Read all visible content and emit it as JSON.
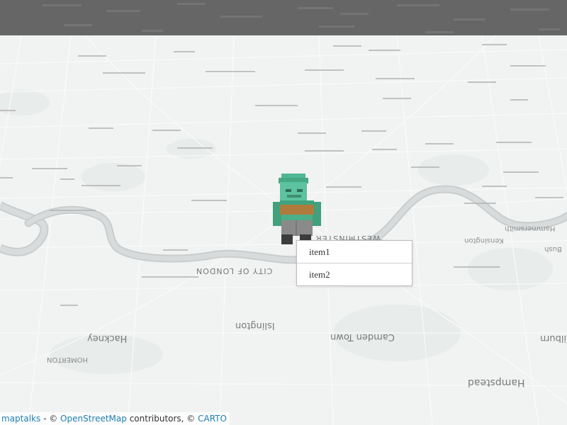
{
  "map": {
    "theme_colors": {
      "sky": "#666666",
      "land": "#f1f2f2",
      "river": "#d6d9da",
      "river_edge": "#c9cdce",
      "park": "#e9edec",
      "road": "#ffffff"
    },
    "labels": [
      {
        "id": "westminster",
        "text": "WESTMINSTER",
        "kind": "district"
      },
      {
        "id": "city-of-london",
        "text": "CITY OF LONDON",
        "kind": "district"
      },
      {
        "id": "islington",
        "text": "Islington",
        "kind": "big"
      },
      {
        "id": "camden-town",
        "text": "Camden Town",
        "kind": "big"
      },
      {
        "id": "hackney",
        "text": "Hackney",
        "kind": "big"
      },
      {
        "id": "hampstead",
        "text": "Hampstead",
        "kind": "big"
      },
      {
        "id": "kilburn",
        "text": "Kilburn",
        "kind": "big"
      },
      {
        "id": "kensington",
        "text": "Kensington",
        "kind": "small"
      },
      {
        "id": "hammersmith",
        "text": "Hammersmith",
        "kind": "small"
      },
      {
        "id": "homerton",
        "text": "HOMERTON",
        "kind": "small"
      },
      {
        "id": "bush",
        "text": "Bush",
        "kind": "small"
      }
    ]
  },
  "marker": {
    "icon": "voxel-character-icon",
    "colors": {
      "hat": "#4fb894",
      "head": "#5cc29f",
      "vest": "#b07a3c",
      "body": "#3fa37e",
      "legs": "#8a8a8a",
      "boots": "#3c3c3c"
    }
  },
  "context_menu": {
    "items": [
      {
        "label": "item1"
      },
      {
        "label": "item2"
      }
    ]
  },
  "attribution": {
    "maptalks": "maptalks",
    "sep1": " - © ",
    "osm": "OpenStreetMap",
    "mid": " contributors, © ",
    "carto": "CARTO"
  }
}
